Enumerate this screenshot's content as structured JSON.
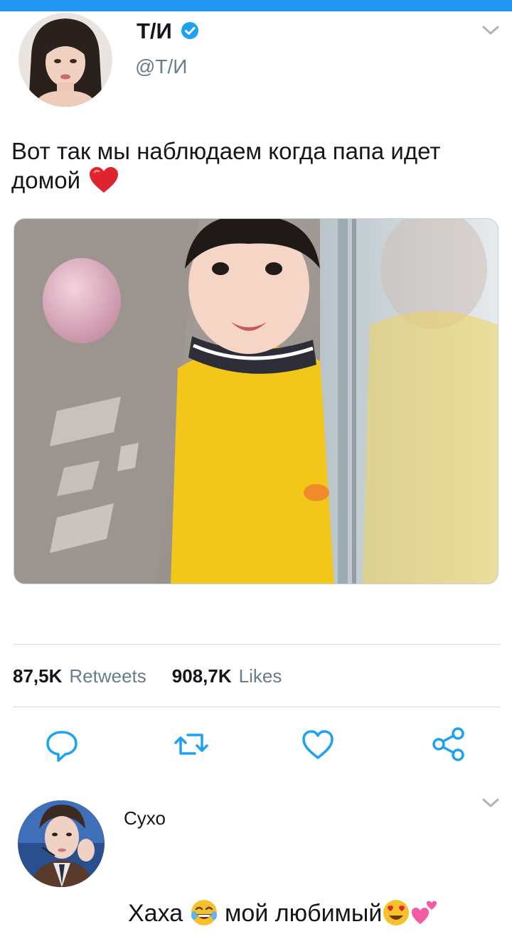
{
  "tweet": {
    "author_name": "Т/И",
    "author_handle": "@Т/И",
    "text": "Вот так мы наблюдаем когда папа идет домой",
    "text_emoji": "red-heart",
    "media_description_icon": "photo"
  },
  "stats": {
    "retweets_count": "87,5K",
    "retweets_label": "Retweets",
    "likes_count": "908,7K",
    "likes_label": "Likes"
  },
  "actions": [
    {
      "name": "reply",
      "icon": "speech-bubble-icon"
    },
    {
      "name": "retweet",
      "icon": "retweet-icon"
    },
    {
      "name": "like",
      "icon": "heart-outline-icon"
    },
    {
      "name": "share",
      "icon": "share-icon"
    }
  ],
  "reply": {
    "author_name": "Сухо",
    "text_part1": "Хаха",
    "text_part2": "мой любимый",
    "emojis": [
      "tears-of-joy",
      "heart-eyes",
      "two-hearts"
    ]
  },
  "colors": {
    "accent": "#2196f3",
    "verified": "#1da1f2",
    "text": "#14171a",
    "secondary": "#6b7b8a",
    "icon": "#1da1f2"
  }
}
